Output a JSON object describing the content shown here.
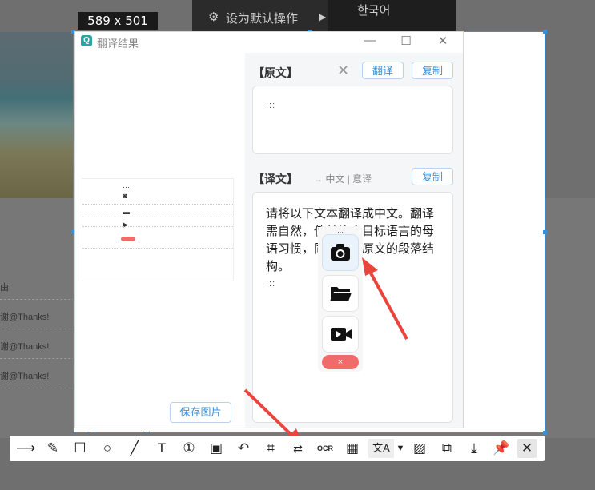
{
  "screen_size_badge": "589 x 501",
  "context_menu": {
    "item_label": "设为默认操作",
    "lang_option": "한국어"
  },
  "background_rows": [
    {
      "text": "由"
    },
    {
      "text": "谢@Thanks!"
    },
    {
      "text": "谢@Thanks!"
    },
    {
      "text": "谢@Thanks!"
    }
  ],
  "window": {
    "title": "翻译结果",
    "source": {
      "heading": "【原文】",
      "translate_label": "翻译",
      "copy_label": "复制",
      "content": ":::"
    },
    "target": {
      "heading": "【译文】",
      "mode": "→ 中文 | 意译",
      "copy_label": "复制",
      "content": "请将以下文本翻译成中文。翻译需自然，使其符合目标语言的母语习惯，同时保留原文的段落结构。",
      "trailing": ":::"
    },
    "save_image_label": "保存图片"
  },
  "widget": {
    "grip": ":::",
    "close_label": "×",
    "buttons": [
      "camera-icon",
      "folder-icon",
      "video-icon"
    ]
  },
  "toolbar": {
    "tools": [
      "arrow",
      "pen",
      "rectangle",
      "ellipse",
      "line",
      "text",
      "number",
      "mosaic",
      "undo",
      "crop",
      "image-translate",
      "ocr",
      "qrcode",
      "translate",
      "blur",
      "copy",
      "download",
      "pin",
      "close"
    ]
  },
  "colors": {
    "accent": "#3a8fd8",
    "close_red": "#f26b6b",
    "annotation_arrow": "#e8463c"
  }
}
